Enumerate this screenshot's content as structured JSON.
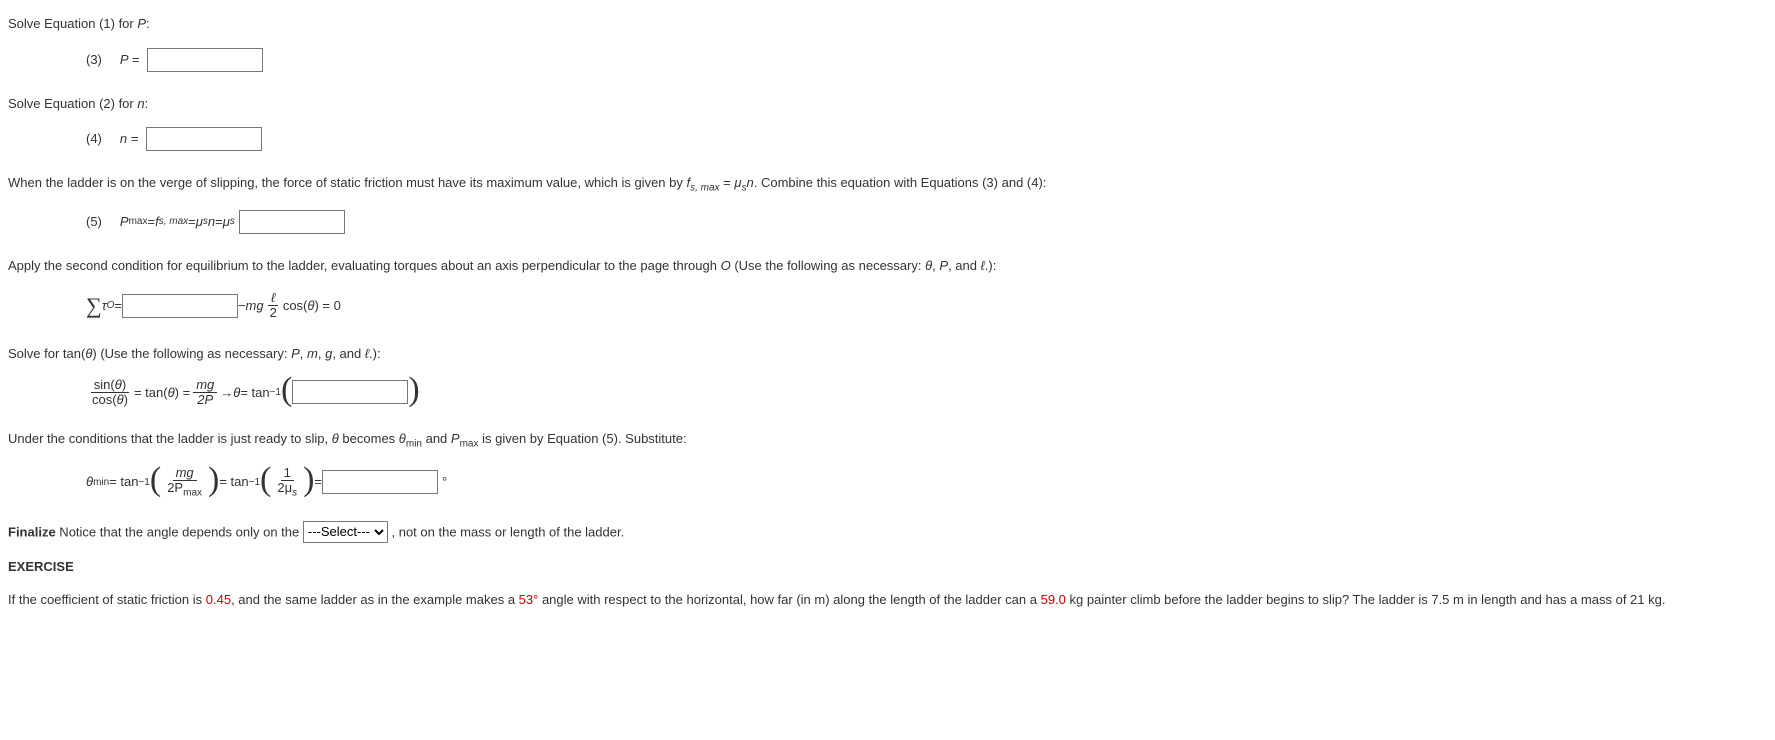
{
  "p1": "Solve Equation (1) for ",
  "p1var": "P",
  "p1end": ":",
  "eq3_num": "(3)",
  "eq3_lhs": "P =",
  "p2": "Solve Equation (2) for ",
  "p2var": "n",
  "p2end": ":",
  "eq4_num": "(4)",
  "eq4_lhs": "n =",
  "p3a": "When the ladder is on the verge of slipping, the force of static friction must have its maximum value, which is given by ",
  "p3_f": "f",
  "p3_fsub": "s, max",
  "p3b": " = ",
  "p3_mu": "μ",
  "p3_musub": "s",
  "p3_n": "n",
  "p3c": ". Combine this equation with Equations (3) and (4):",
  "eq5_num": "(5)",
  "eq5_P": "P",
  "eq5_Psub": "max",
  "eq5_eq1": " = ",
  "eq5_f": "f",
  "eq5_fsub": "s, max",
  "eq5_eq2": " = ",
  "eq5_mu1": "μ",
  "eq5_mu1sub": "s",
  "eq5_n": "n",
  "eq5_eq3": " = ",
  "eq5_mu2": "μ",
  "eq5_mu2sub": "s",
  "p4a": "Apply the second condition for equilibrium to the ladder, evaluating torques about an axis perpendicular to the page through ",
  "p4_O": "O",
  "p4b": " (Use the following as necessary: ",
  "p4_theta": "θ",
  "p4_c1": ", ",
  "p4_P": "P",
  "p4_c2": ", and ",
  "p4_ell": "ℓ",
  "p4_end": ".):",
  "eq_tau_sigma": "∑",
  "eq_tau_tau": "τ",
  "eq_tau_sub": "O",
  "eq_tau_eq": " = ",
  "eq_tau_minus": " − ",
  "eq_tau_mg": "mg",
  "eq_tau_ell": "ℓ",
  "eq_tau_2": "2",
  "eq_tau_cos": " cos(",
  "eq_tau_theta": "θ",
  "eq_tau_close": ") = 0",
  "p5a": "Solve for tan(",
  "p5_theta": "θ",
  "p5b": ") (Use the following as necessary: ",
  "p5_P": "P",
  "p5_c1": ", ",
  "p5_m": "m",
  "p5_c2": ", ",
  "p5_g": "g",
  "p5_c3": ", and ",
  "p5_ell": "ℓ",
  "p5_end": ".):",
  "eq_tan_sin": "sin(",
  "eq_tan_theta1": "θ",
  "eq_tan_close1": ")",
  "eq_tan_cos": "cos(",
  "eq_tan_theta2": "θ",
  "eq_tan_close2": ")",
  "eq_tan_eq1": " = tan(",
  "eq_tan_theta3": "θ",
  "eq_tan_close3": ") = ",
  "eq_tan_mg": "mg",
  "eq_tan_2P": "2P",
  "eq_tan_arrow": " → ",
  "eq_tan_theta4": "θ",
  "eq_tan_eq2": " = tan",
  "eq_tan_neg1": "−1",
  "p6a": "Under the conditions that the ladder is just ready to slip, ",
  "p6_theta": "θ",
  "p6b": " becomes ",
  "p6_theta2": "θ",
  "p6_sub1": "min",
  "p6c": " and ",
  "p6_P": "P",
  "p6_sub2": "max",
  "p6d": " is given by Equation (5). Substitute:",
  "eq_fin_theta": "θ",
  "eq_fin_sub": "min",
  "eq_fin_eq1": " = tan",
  "eq_fin_neg1": "−1",
  "eq_fin_mg": "mg",
  "eq_fin_2P": "2P",
  "eq_fin_Psub": "max",
  "eq_fin_eq2": " = tan",
  "eq_fin_neg2": "−1",
  "eq_fin_1": "1",
  "eq_fin_2mu": "2μ",
  "eq_fin_musub": "s",
  "eq_fin_eq3": " = ",
  "eq_fin_deg": "°",
  "finalize_bold": "Finalize",
  "finalize_a": " Notice that the angle depends only on the ",
  "select_placeholder": "---Select---",
  "finalize_b": " , not on the mass or length of the ladder.",
  "exercise": "EXERCISE",
  "ex_a": "If the coefficient of static friction is ",
  "ex_mu": "0.45",
  "ex_b": ", and the same ladder as in the example makes a ",
  "ex_ang": "53°",
  "ex_c": " angle with respect to the horizontal, how far (in m) along the length of the ladder can a ",
  "ex_mass": "59.0",
  "ex_d": " kg painter climb before the ladder begins to slip? The ladder is 7.5 m in length and has a mass of 21 kg."
}
